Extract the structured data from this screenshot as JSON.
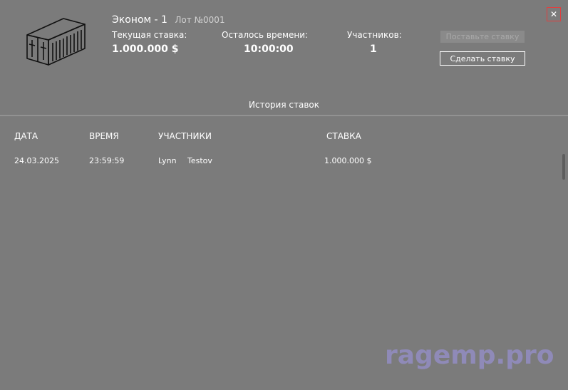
{
  "lot": {
    "title": "Эконом - 1",
    "number": "Лот №0001",
    "icon": "shipping-container-icon"
  },
  "stats": {
    "current_bid_label": "Текущая ставка:",
    "current_bid_value": "1.000.000 $",
    "time_left_label": "Осталось времени:",
    "time_left_value": "10:00:00",
    "participants_label": "Участников:",
    "participants_value": "1"
  },
  "bid": {
    "placeholder": "Поставьте ставку",
    "button_label": "Сделать ставку"
  },
  "close": {
    "icon": "close-icon",
    "glyph": "✕",
    "border_color": "#e04040"
  },
  "history": {
    "title": "История ставок",
    "columns": {
      "date": "ДАТА",
      "time": "ВРЕМЯ",
      "participants": "УЧАСТНИКИ",
      "bid": "СТАВКА"
    },
    "rows": [
      {
        "date": "24.03.2025",
        "time": "23:59:59",
        "first_name": "Lynn",
        "last_name": "Testov",
        "bid": "1.000.000 $"
      }
    ]
  },
  "watermark": {
    "text": "ragemp.pro"
  },
  "colors": {
    "background": "#7b7b7b",
    "text": "#ffffff",
    "close_border": "#e04040",
    "watermark": "#8f8ab8"
  }
}
